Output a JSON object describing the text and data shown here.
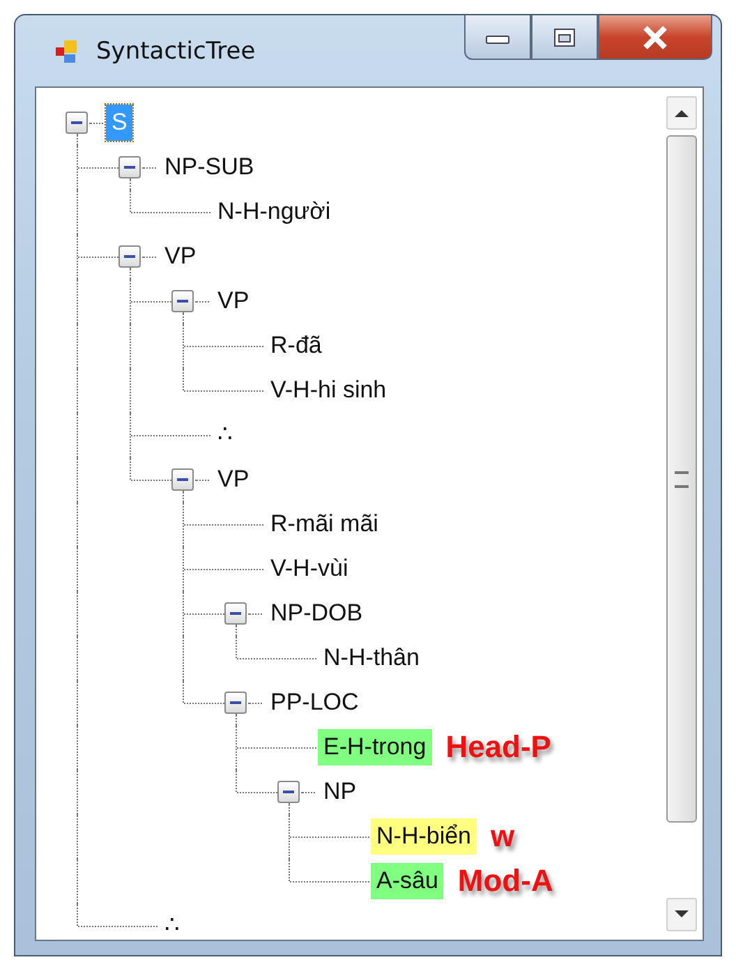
{
  "window": {
    "title": "SyntacticTree"
  },
  "tree": {
    "label": "S",
    "selected": true,
    "expanded": true,
    "children": [
      {
        "label": "NP-SUB",
        "selected": false,
        "expanded": true,
        "children": [
          {
            "label": "N-H-người",
            "selected": false
          }
        ]
      },
      {
        "label": "VP",
        "selected": false,
        "expanded": true,
        "children": [
          {
            "label": "VP",
            "selected": false,
            "expanded": true,
            "children": [
              {
                "label": "R-đã",
                "selected": false
              },
              {
                "label": "V-H-hi sinh",
                "selected": false
              }
            ]
          },
          {
            "label": "∴",
            "selected": false
          },
          {
            "label": "VP",
            "selected": false,
            "expanded": true,
            "children": [
              {
                "label": "R-mãi mãi",
                "selected": false
              },
              {
                "label": "V-H-vùi",
                "selected": false
              },
              {
                "label": "NP-DOB",
                "selected": false,
                "expanded": true,
                "children": [
                  {
                    "label": "N-H-thân",
                    "selected": false
                  }
                ]
              },
              {
                "label": "PP-LOC",
                "selected": false,
                "expanded": true,
                "children": [
                  {
                    "label": "E-H-trong",
                    "selected": false,
                    "color": "#80ff80",
                    "annotation": "Head-P"
                  },
                  {
                    "label": "NP",
                    "selected": false,
                    "expanded": true,
                    "children": [
                      {
                        "label": "N-H-biển",
                        "selected": false,
                        "color": "#ffff80",
                        "annotation": "w"
                      },
                      {
                        "label": "A-sâu",
                        "selected": false,
                        "color": "#80ff80",
                        "annotation": "Mod-A"
                      }
                    ]
                  }
                ]
              }
            ]
          }
        ]
      },
      {
        "label": "∴",
        "selected": false
      }
    ]
  }
}
